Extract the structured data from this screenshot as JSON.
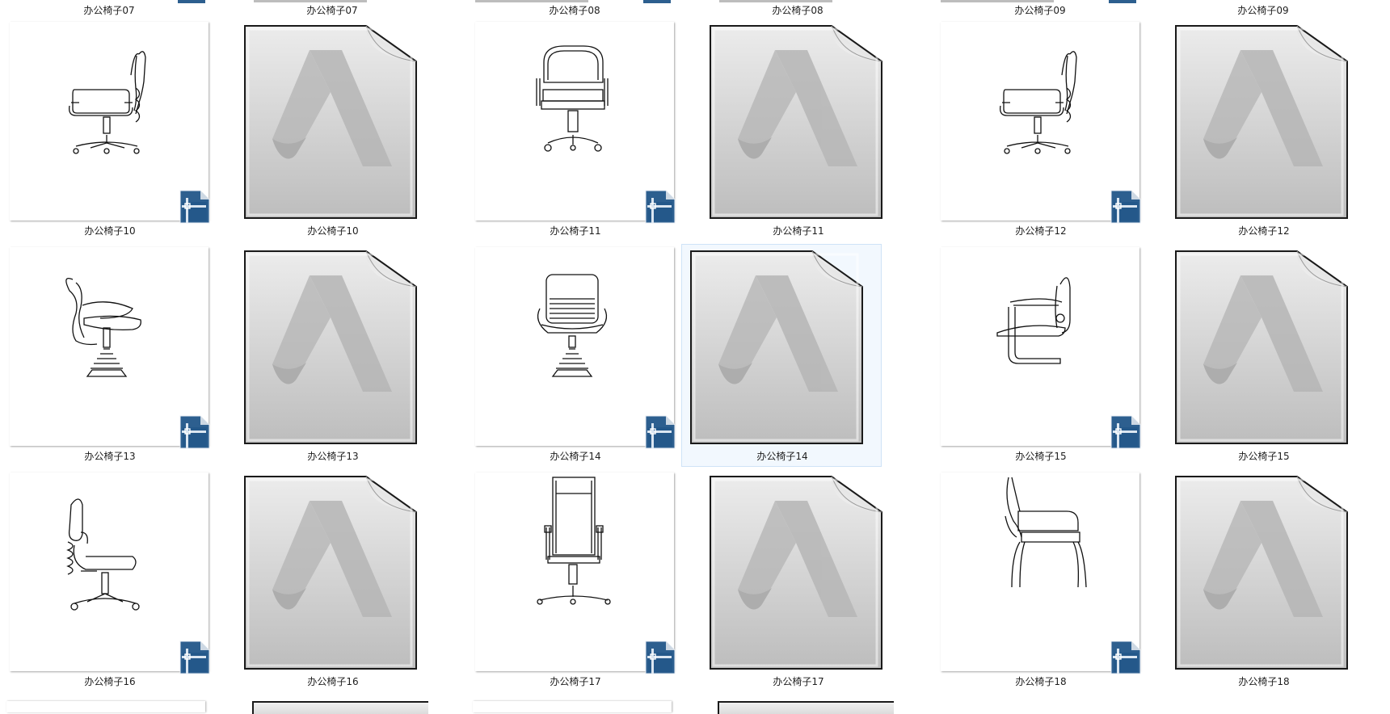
{
  "top_labels": [
    "办公椅子07",
    "办公椅子07",
    "办公椅子08",
    "办公椅子08",
    "办公椅子09",
    "办公椅子09"
  ],
  "rows": [
    [
      {
        "type": "dwg",
        "label": "办公椅子10",
        "icon": "office-swivel-chair-side-drawing"
      },
      {
        "type": "doc",
        "label": "办公椅子10",
        "icon": "autocad-file-icon"
      },
      {
        "type": "dwg",
        "label": "办公椅子11",
        "icon": "office-swivel-chair-front-drawing"
      },
      {
        "type": "doc",
        "label": "办公椅子11",
        "icon": "autocad-file-icon"
      },
      {
        "type": "dwg",
        "label": "办公椅子12",
        "icon": "office-swivel-chair-side-drawing"
      },
      {
        "type": "doc",
        "label": "办公椅子12",
        "icon": "autocad-file-icon"
      }
    ],
    [
      {
        "type": "dwg",
        "label": "办公椅子13",
        "icon": "pedestal-chair-side-drawing"
      },
      {
        "type": "doc",
        "label": "办公椅子13",
        "icon": "autocad-file-icon"
      },
      {
        "type": "dwg",
        "label": "办公椅子14",
        "icon": "pedestal-chair-front-drawing"
      },
      {
        "type": "doc",
        "label": "办公椅子14",
        "icon": "autocad-file-icon",
        "selected": true
      },
      {
        "type": "dwg",
        "label": "办公椅子15",
        "icon": "cantilever-chair-side-drawing"
      },
      {
        "type": "doc",
        "label": "办公椅子15",
        "icon": "autocad-file-icon"
      }
    ],
    [
      {
        "type": "dwg",
        "label": "办公椅子16",
        "icon": "task-chair-side-drawing"
      },
      {
        "type": "doc",
        "label": "办公椅子16",
        "icon": "autocad-file-icon"
      },
      {
        "type": "dwg",
        "label": "办公椅子17",
        "icon": "highback-chair-front-drawing"
      },
      {
        "type": "doc",
        "label": "办公椅子17",
        "icon": "autocad-file-icon"
      },
      {
        "type": "dwg",
        "label": "办公椅子18",
        "icon": "armchair-side-drawing"
      },
      {
        "type": "doc",
        "label": "办公椅子18",
        "icon": "autocad-file-icon"
      }
    ]
  ],
  "colors": {
    "selection_bg": "#f2f8fe",
    "selection_border": "#cfe3f7",
    "badge_blue": "#2d5f8f",
    "doc_gray": "#c4c4c4"
  }
}
